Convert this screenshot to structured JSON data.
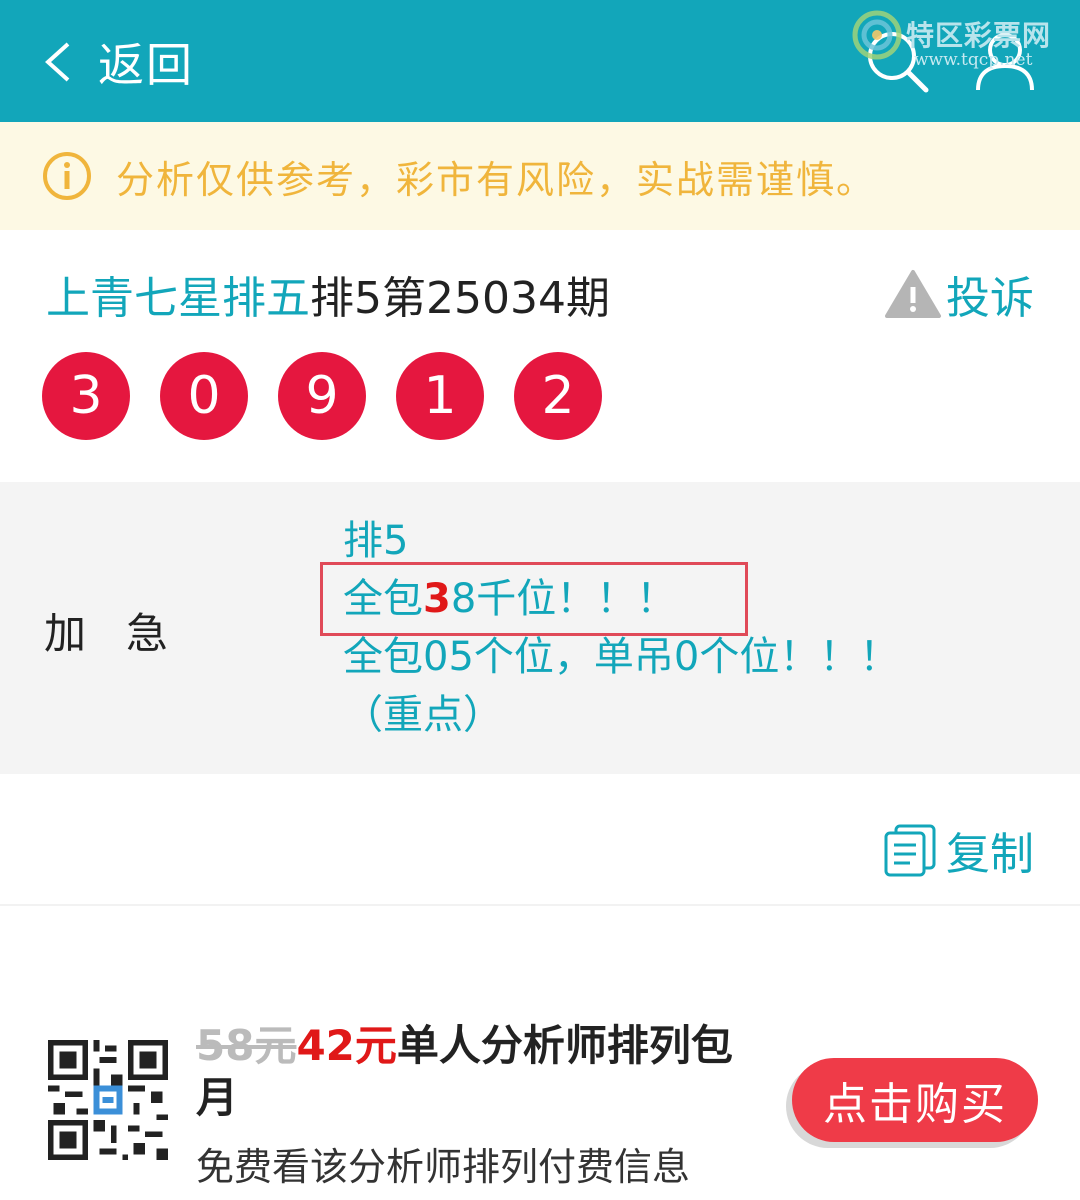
{
  "header": {
    "back_label": "返回",
    "accent_color": "#12a6ba",
    "icons": [
      "back-chevron-icon",
      "search-icon",
      "user-icon"
    ]
  },
  "watermark": {
    "title": "特区彩票网",
    "url": "www.tqcp.net"
  },
  "notice": {
    "text": "分析仅供参考，彩市有风险，实战需谨慎。",
    "icon": "info-icon"
  },
  "post": {
    "analyst": "上青七星排五",
    "issue": "排5第25034期",
    "complain_label": "投诉",
    "balls": [
      "3",
      "0",
      "9",
      "1",
      "2"
    ],
    "ball_color": "#e5173f"
  },
  "content": {
    "tag": "加急",
    "line1": "排5",
    "line2_prefix": "全包",
    "line2_highlight": "3",
    "line2_suffix": "8千位！！！",
    "line3": "全包05个位，单吊0个位！！！",
    "line4": "（重点）"
  },
  "actions": {
    "copy_label": "复制"
  },
  "promo": {
    "old_price": "58元",
    "new_price": "42元",
    "title": "单人分析师排列包月",
    "subtitle": "免费看该分析师排列付费信息",
    "buy_label": "点击购买"
  }
}
